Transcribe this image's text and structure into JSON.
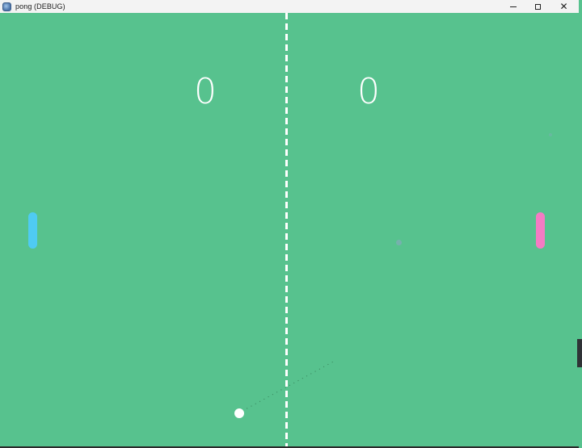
{
  "window": {
    "title": "pong (DEBUG)",
    "icon": "app-icon",
    "controls": [
      "minimize-icon",
      "maximize-icon",
      "close-icon"
    ]
  },
  "game": {
    "background_color": "#57c28e",
    "score_left": "0",
    "score_right": "0",
    "paddle_left_color": "#4fcbf2",
    "paddle_right_color": "#f57bc3",
    "ball_color": "#ffffff"
  }
}
